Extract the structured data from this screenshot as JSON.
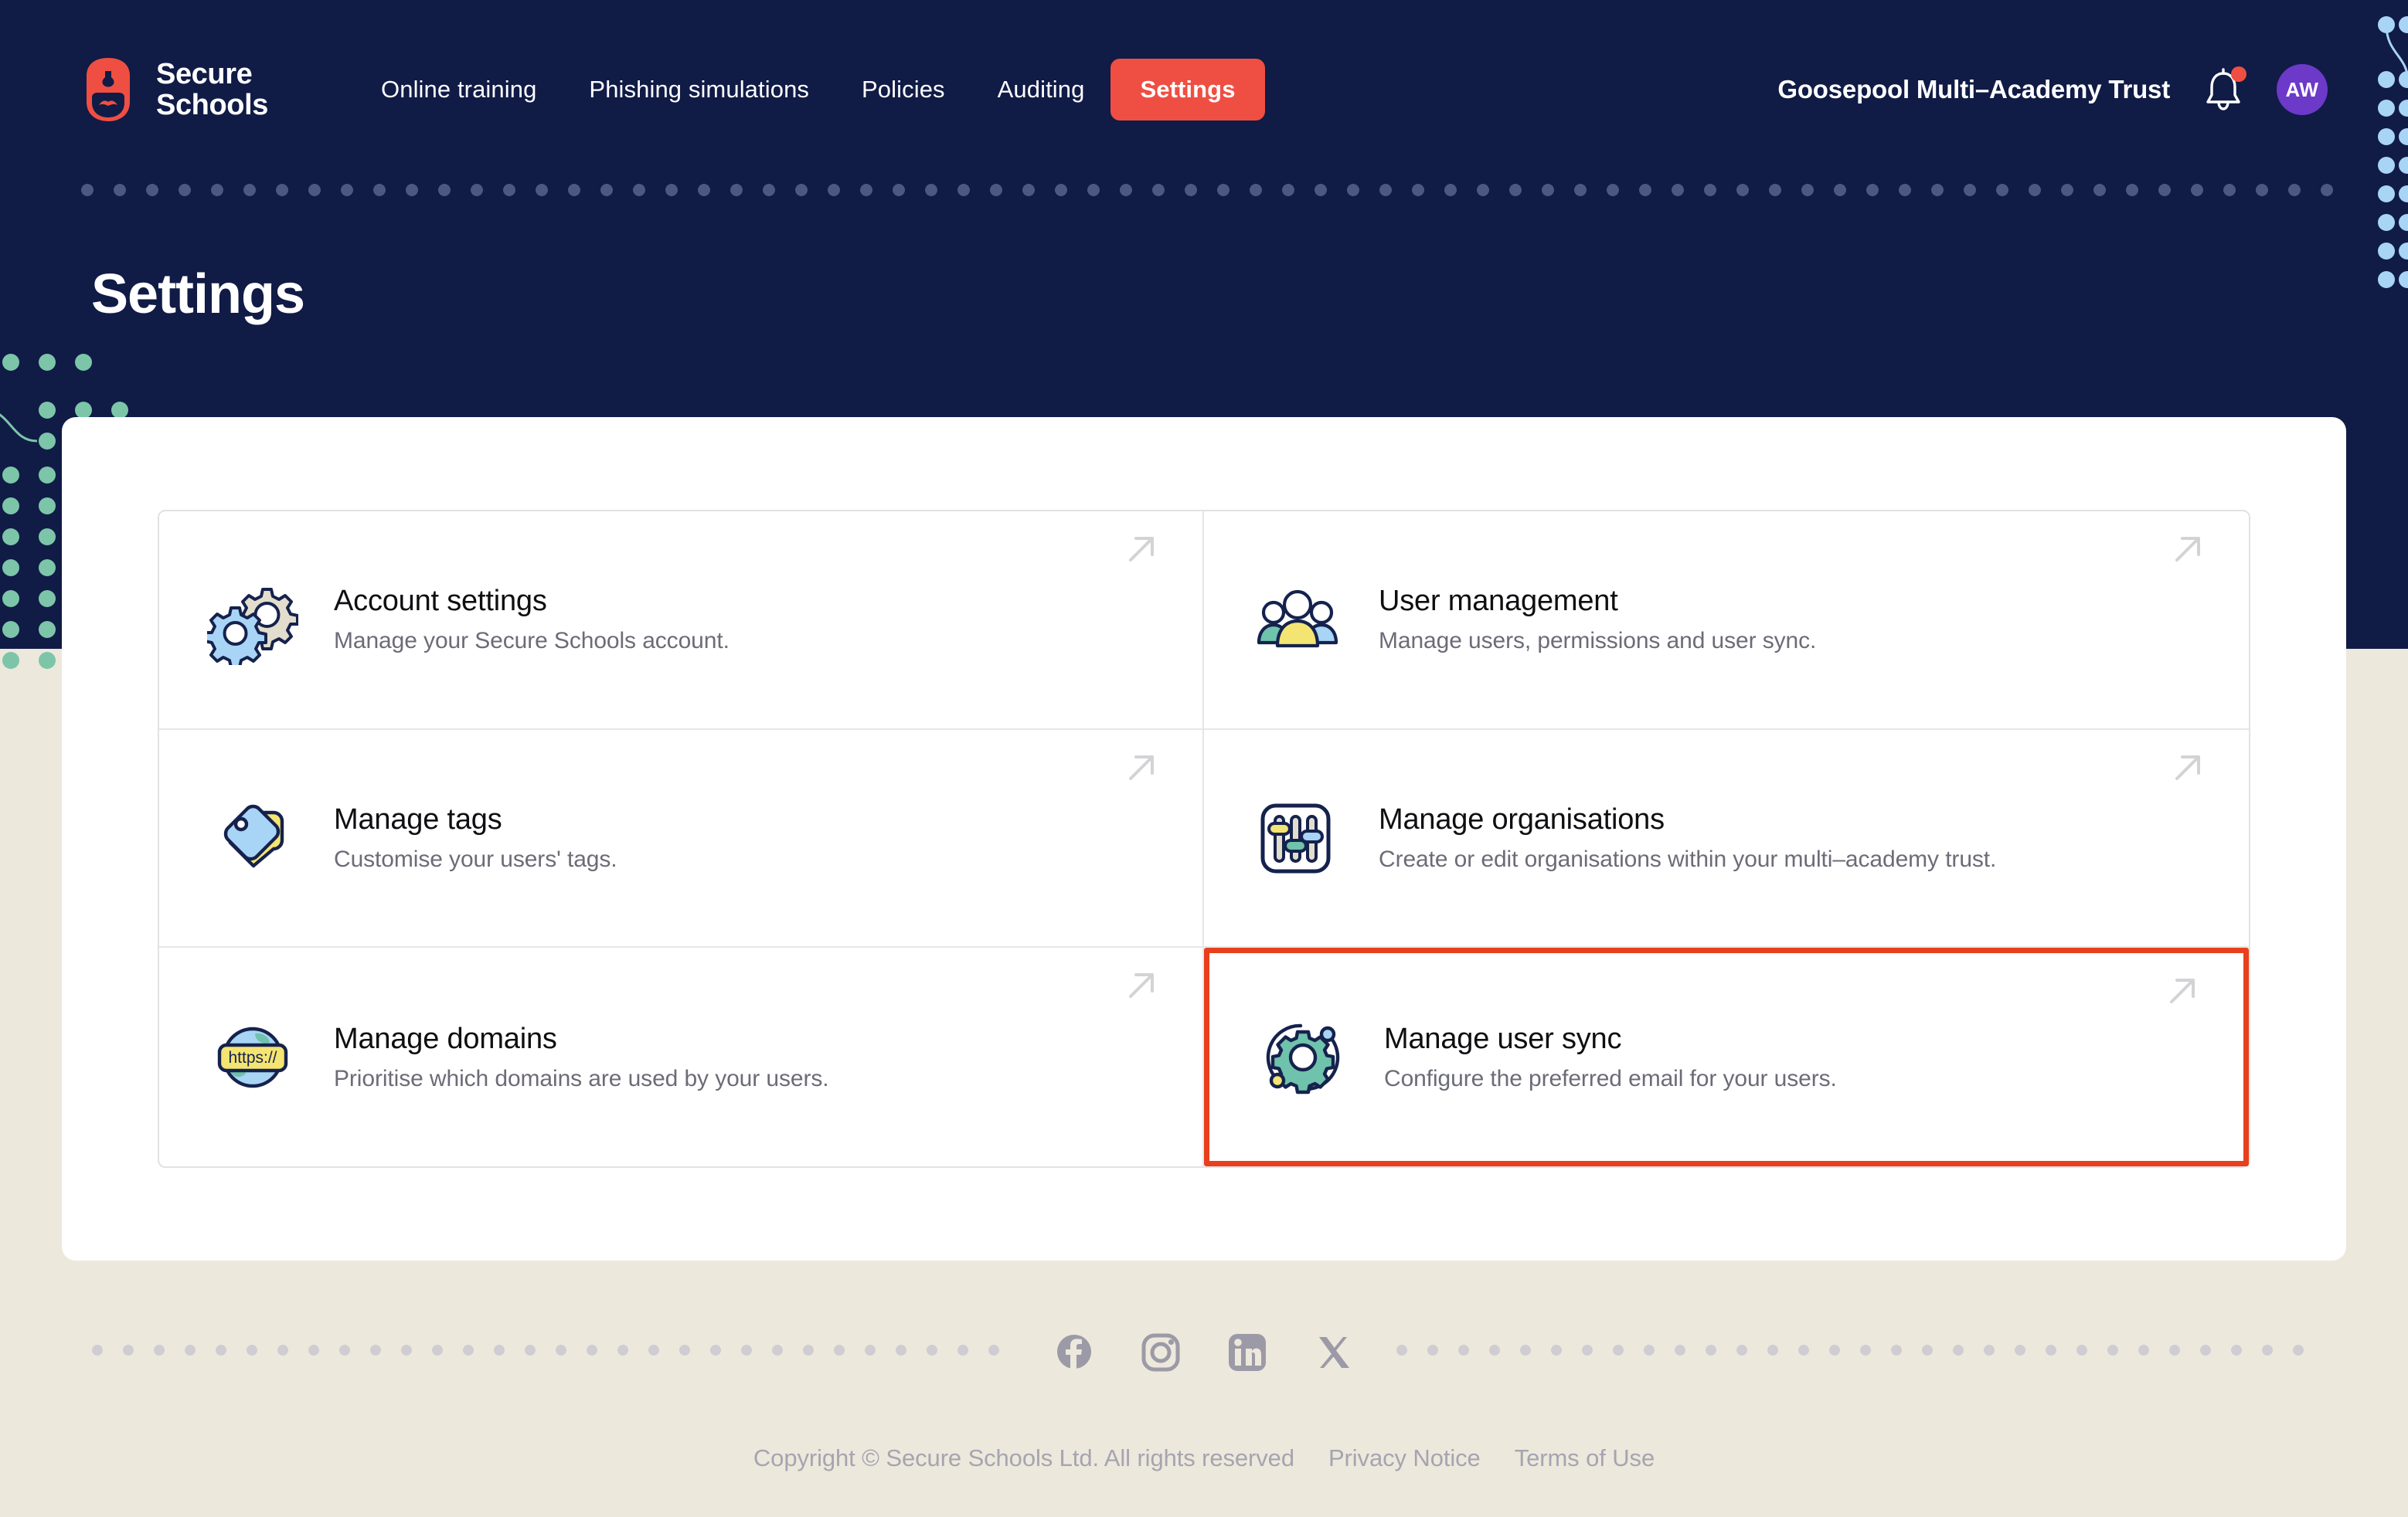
{
  "brand": {
    "line1": "Secure",
    "line2": "Schools",
    "logo_icon": "secure-schools-padlock-logo"
  },
  "nav": {
    "items": [
      {
        "label": "Online training",
        "active": false
      },
      {
        "label": "Phishing simulations",
        "active": false
      },
      {
        "label": "Policies",
        "active": false
      },
      {
        "label": "Auditing",
        "active": false
      },
      {
        "label": "Settings",
        "active": true
      }
    ]
  },
  "header": {
    "organisation": "Goosepool Multi–Academy Trust",
    "notifications_icon": "bell-icon",
    "notification_badge": true,
    "avatar_initials": "AW"
  },
  "page": {
    "title": "Settings"
  },
  "cards": [
    {
      "title": "Account settings",
      "subtitle": "Manage your Secure Schools account.",
      "icon": "gears-icon",
      "arrow_icon": "arrow-up-right-icon",
      "highlighted": false
    },
    {
      "title": "User management",
      "subtitle": "Manage users, permissions and user sync.",
      "icon": "users-group-icon",
      "arrow_icon": "arrow-up-right-icon",
      "highlighted": false
    },
    {
      "title": "Manage tags",
      "subtitle": "Customise your users' tags.",
      "icon": "tags-icon",
      "arrow_icon": "arrow-up-right-icon",
      "highlighted": false
    },
    {
      "title": "Manage organisations",
      "subtitle": "Create or edit organisations within your multi–academy trust.",
      "icon": "sliders-icon",
      "arrow_icon": "arrow-up-right-icon",
      "highlighted": false
    },
    {
      "title": "Manage domains",
      "subtitle": "Prioritise which domains are used by your users.",
      "icon": "globe-https-icon",
      "arrow_icon": "arrow-up-right-icon",
      "highlighted": false
    },
    {
      "title": "Manage user sync",
      "subtitle": "Configure the preferred email for your users.",
      "icon": "gear-sync-icon",
      "arrow_icon": "arrow-up-right-icon",
      "highlighted": true
    }
  ],
  "icon_labels": {
    "globe_banner_text": "https://"
  },
  "footer": {
    "social": [
      {
        "name": "facebook-icon"
      },
      {
        "name": "instagram-icon"
      },
      {
        "name": "linkedin-icon"
      },
      {
        "name": "x-twitter-icon"
      }
    ],
    "copyright": "Copyright © Secure Schools Ltd. All rights reserved",
    "privacy": "Privacy Notice",
    "terms": "Terms of Use"
  },
  "colors": {
    "navy": "#101b46",
    "accent_red": "#ef4f42",
    "highlight_red": "#e8401c",
    "page_bg": "#ece8dc",
    "avatar_purple": "#6c39c9",
    "deco_green": "#7cc5a9",
    "deco_blue": "#a8d4f5"
  }
}
